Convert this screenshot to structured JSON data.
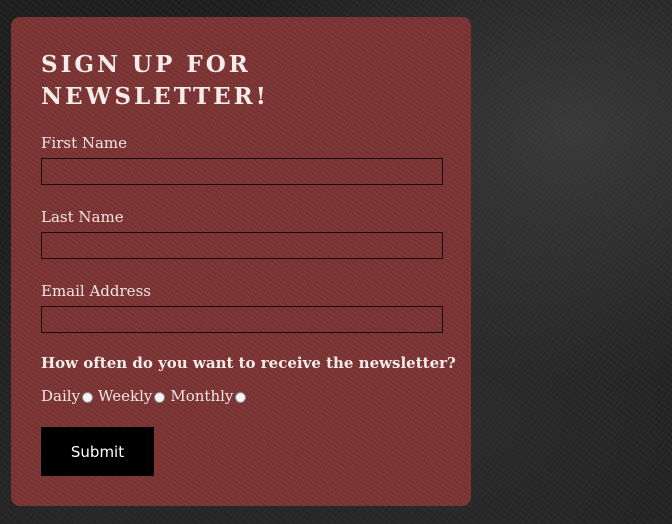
{
  "form": {
    "title": "Sign up for Newsletter!",
    "fields": [
      {
        "label": "First Name",
        "value": "",
        "placeholder": ""
      },
      {
        "label": "Last Name",
        "value": "",
        "placeholder": ""
      },
      {
        "label": "Email Address",
        "value": "",
        "placeholder": ""
      }
    ],
    "frequency": {
      "question": "How often do you want to receive the newsletter?",
      "options": [
        {
          "label": "Daily",
          "selected": false
        },
        {
          "label": "Weekly",
          "selected": false
        },
        {
          "label": "Monthly",
          "selected": false
        }
      ]
    },
    "submit_label": "Submit"
  },
  "colors": {
    "card_background": "#7d3333",
    "page_background": "#1e1e1e",
    "submit_background": "#000000",
    "text": "#f3ecea"
  }
}
